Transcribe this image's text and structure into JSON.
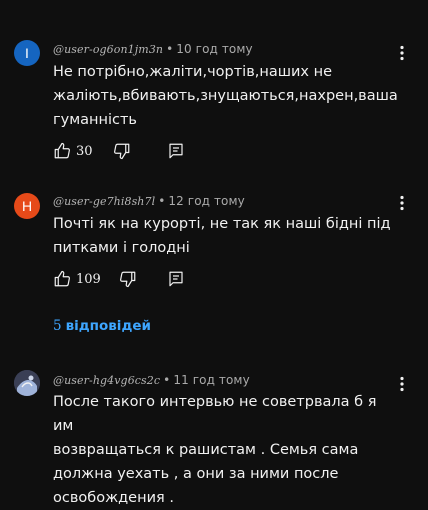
{
  "comments": [
    {
      "avatar_letter": "I",
      "avatar_color": "#1565c0",
      "handle": "@user-og6on1jm3n",
      "time": "10 год тому",
      "text_lines": [
        "Не потрібно,жаліти,чортів,наших не",
        "жаліють,вбивають,знущаються,нахрен,ваша",
        "гуманність"
      ],
      "likes": "30"
    },
    {
      "avatar_letter": "H",
      "avatar_color": "#e64a19",
      "handle": "@user-ge7hi8sh7l",
      "time": "12 год тому",
      "text_lines": [
        "Почті як на курорті, не так як наші бідні під",
        "питками і голодні"
      ],
      "likes": "109"
    },
    {
      "avatar_letter": "",
      "avatar_color": "#3a3f55",
      "handle": "@user-hg4vg6cs2c",
      "time": "11 год тому",
      "text_lines": [
        "После такого интервью не советрвала б я им",
        "возвращаться к рашистам . Семья сама",
        "должна уехать , а они за ними после",
        "освобождения ."
      ],
      "likes": ""
    }
  ],
  "replies": {
    "count": "5",
    "label": "відповідей"
  },
  "icons": {
    "like": "thumb-up-icon",
    "dislike": "thumb-down-icon",
    "reply": "reply-icon",
    "menu": "more-vert-icon"
  },
  "colors": {
    "background": "#0f0f0f",
    "text": "#f1f1f1",
    "meta": "#aaaaaa",
    "link": "#3ea6ff"
  }
}
